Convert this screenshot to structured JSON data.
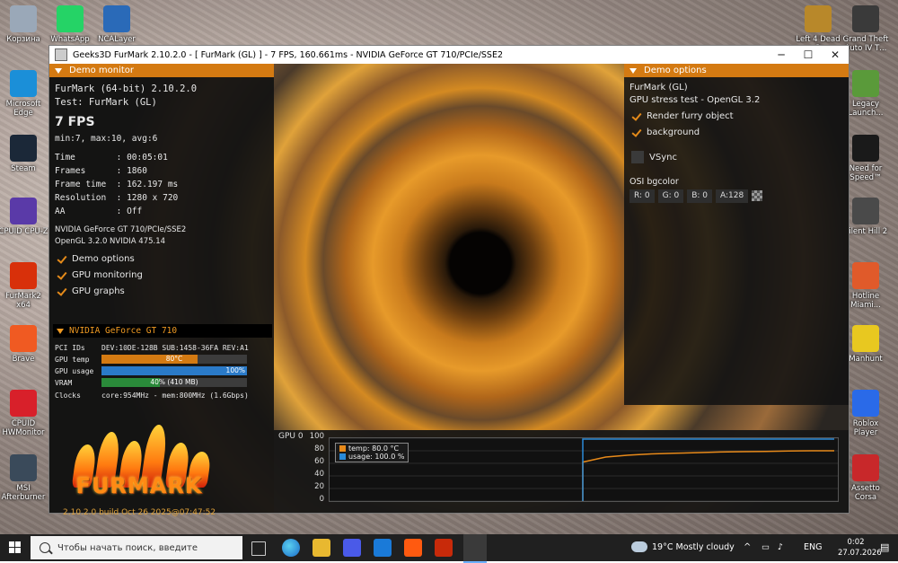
{
  "desktop": {
    "left_icons": [
      {
        "label": "Корзина",
        "color": "#9aa8b8"
      },
      {
        "label": "Microsoft Edge",
        "color": "#1b8fd8"
      },
      {
        "label": "Steam",
        "color": "#1b2838"
      },
      {
        "label": "CPUID CPU-Z",
        "color": "#5a3aa8"
      },
      {
        "label": "FurMark2 x64",
        "color": "#d8300a"
      },
      {
        "label": "Brave",
        "color": "#f05a22"
      },
      {
        "label": "CPUID HWMonitor",
        "color": "#d8202a"
      },
      {
        "label": "MSI Afterburner",
        "color": "#3a4a5a"
      }
    ],
    "top_icons": [
      {
        "label": "WhatsApp",
        "color": "#25d366"
      },
      {
        "label": "NCALayer",
        "color": "#2a6ab8"
      }
    ],
    "right_icons": [
      {
        "label": "Left 4 Dead 2",
        "color": "#b8882a"
      },
      {
        "label": "Grand Theft Auto IV Т...",
        "color": "#3a3a3a"
      },
      {
        "label": "Legacy Launch...",
        "color": "#5a9a3a"
      },
      {
        "label": "Need for Speed™ Mo...",
        "color": "#1a1a1a"
      },
      {
        "label": "Silent Hill 2",
        "color": "#4a4a4a"
      },
      {
        "label": "Hotline Miami...",
        "color": "#e05a2a"
      },
      {
        "label": "Manhunt",
        "color": "#e8c820"
      },
      {
        "label": "Roblox Player",
        "color": "#2a6ae8"
      },
      {
        "label": "Assetto Corsa",
        "color": "#c8282a"
      }
    ]
  },
  "window": {
    "title": "Geeks3D FurMark 2.10.2.0 - [ FurMark (GL) ] - 7 FPS, 160.661ms - NVIDIA GeForce GT 710/PCIe/SSE2",
    "minimize": "─",
    "maximize": "☐",
    "close": "✕"
  },
  "demo_monitor": {
    "header": "Demo monitor",
    "line1": "FurMark (64-bit) 2.10.2.0",
    "line2": "Test: FurMark (GL)",
    "fps": "7 FPS",
    "fps_stats": "min:7, max:10, avg:6",
    "time": "Time        : 00:05:01",
    "frames": "Frames      : 1860",
    "frame_time": "Frame time  : 162.197 ms",
    "resolution": "Resolution  : 1280 x 720",
    "aa": "AA          : Off",
    "gpu_name": "NVIDIA GeForce GT 710/PCIe/SSE2",
    "opengl": "OpenGL 3.2.0 NVIDIA 475.14",
    "cb_demo_options": "Demo options",
    "cb_gpu_monitoring": "GPU monitoring",
    "cb_gpu_graphs": "GPU graphs",
    "gpu_header": "NVIDIA GeForce GT 710",
    "pci_label": "PCI IDs",
    "pci_value": "DEV:10DE-128B SUB:1458-36FA REV:A1",
    "temp_label": "GPU temp",
    "temp_text": "80°C",
    "temp_fraction": 0.66,
    "usage_label": "GPU usage",
    "usage_text": "100%",
    "usage_fraction": 1.0,
    "vram_label": "VRAM",
    "vram_text": "40% (410 MB)",
    "vram_fraction": 0.4,
    "clocks_label": "Clocks",
    "clocks_value": "core:954MHz - mem:800MHz (1.6Gbps)",
    "logo_text": "FURMARK",
    "build": "2.10.2.0 build Oct 26 2025@07:47:52"
  },
  "demo_options": {
    "header": "Demo options",
    "line1": "FurMark (GL)",
    "line2": "GPU stress test - OpenGL 3.2",
    "cb_render_furry": "Render furry object",
    "cb_background": "background",
    "cb_vsync": "VSync",
    "osi_label": "OSI bgcolor",
    "r": "R: 0",
    "g": "G: 0",
    "b": "B: 0",
    "a": "A:128"
  },
  "graph": {
    "title": "GPU 0",
    "y_ticks": [
      "100",
      "80",
      "60",
      "40",
      "20",
      "0"
    ],
    "legend_temp": "temp: 80.0 °C",
    "legend_usage": "usage: 100.0 %",
    "temp_color": "#e88a1a",
    "usage_color": "#2a8ad8"
  },
  "chart_data": {
    "type": "line",
    "ylim": [
      0,
      100
    ],
    "series": [
      {
        "name": "temp: 80.0 °C",
        "values": [
          62,
          70,
          73,
          75,
          76,
          77,
          78,
          78.5,
          79,
          79.5,
          80,
          80
        ]
      },
      {
        "name": "usage: 100.0 %",
        "values": [
          100,
          100,
          100,
          100,
          100,
          100,
          100,
          100,
          100,
          100,
          100,
          100
        ]
      }
    ]
  },
  "taskbar": {
    "search_placeholder": "Чтобы начать поиск, введите",
    "weather": "19°C  Mostly cloudy",
    "lang": "ENG",
    "time": "0:02",
    "date": "27.07.2026"
  }
}
